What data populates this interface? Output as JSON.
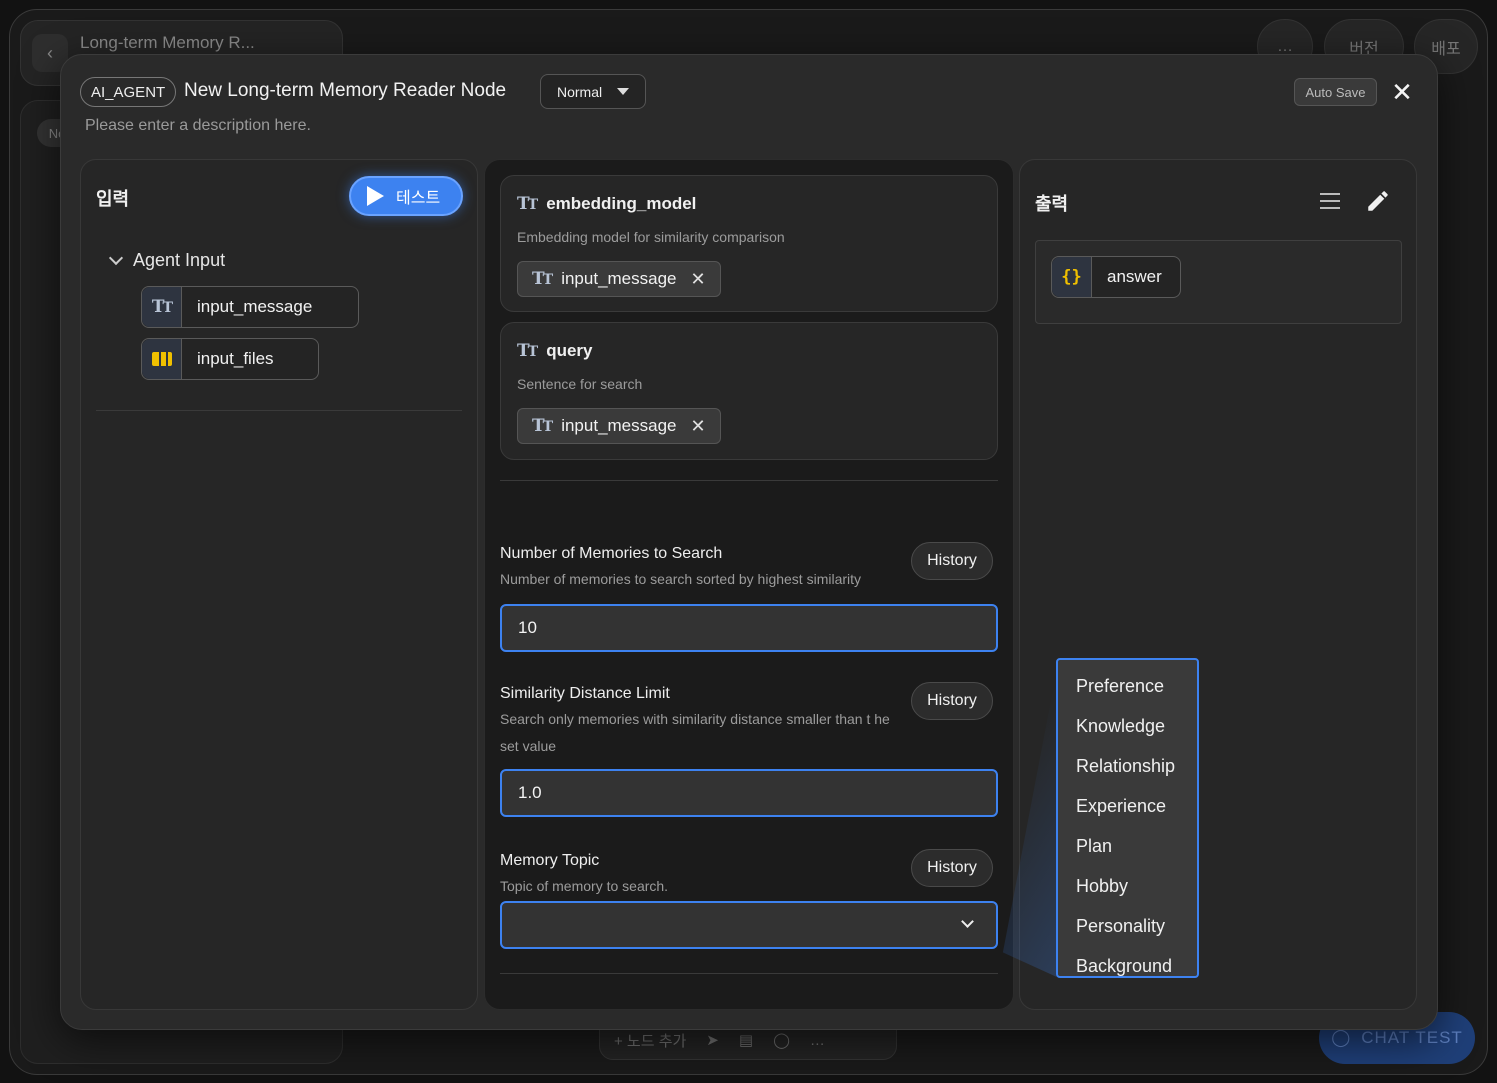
{
  "background": {
    "title": "Long-term Memory R...",
    "sidebar_badge": "No",
    "top_buttons": {
      "more": "…",
      "version": "버전",
      "deploy": "배포"
    },
    "toolbar": {
      "add_node": "+ 노드 추가",
      "more": "…"
    },
    "chat_test": "CHAT TEST"
  },
  "modal": {
    "type_chip": "AI_AGENT",
    "title": "New Long-term Memory Reader Node",
    "mode": "Normal",
    "description_placeholder": "Please enter a description here.",
    "auto_save": "Auto Save",
    "close": "✕"
  },
  "input_panel": {
    "heading": "입력",
    "test_button": "테스트",
    "group": "Agent Input",
    "variables": [
      {
        "name": "input_message",
        "icon": "text-type-icon"
      },
      {
        "name": "input_files",
        "icon": "files-icon"
      }
    ]
  },
  "params": {
    "embedding_model": {
      "title": "embedding_model",
      "desc": "Embedding model for similarity comparison",
      "value": "input_message"
    },
    "query": {
      "title": "query",
      "desc": "Sentence for search",
      "value": "input_message"
    },
    "num_memories": {
      "label": "Number of Memories to Search",
      "help": "Number of memories to search sorted by highest similarity",
      "value": "10",
      "history": "History"
    },
    "similarity": {
      "label": "Similarity Distance Limit",
      "help": "Search only memories with similarity distance smaller than t he set value",
      "value": "1.0",
      "history": "History"
    },
    "memory_topic": {
      "label": "Memory Topic",
      "help": "Topic of memory to search.",
      "value": "",
      "history": "History",
      "options": [
        "Preference",
        "Knowledge",
        "Relationship",
        "Experience",
        "Plan",
        "Hobby",
        "Personality",
        "Background"
      ]
    }
  },
  "output_panel": {
    "heading": "출력",
    "output": "answer"
  },
  "colors": {
    "accent": "#3d82f0",
    "file_icon": "#f0c000"
  }
}
